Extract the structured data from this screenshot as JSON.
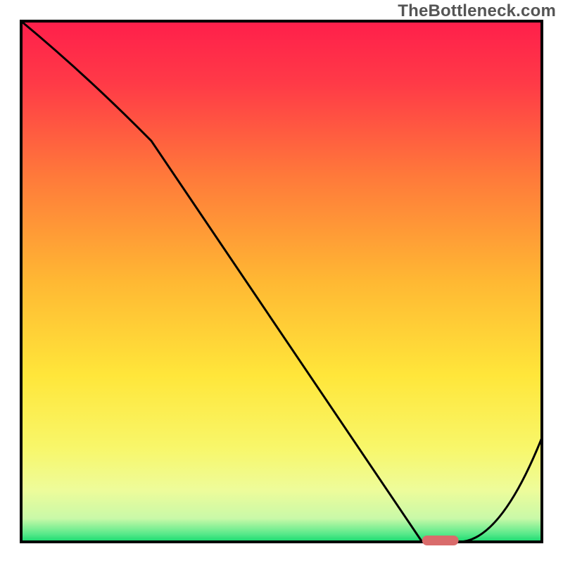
{
  "watermark": "TheBottleneck.com",
  "chart_data": {
    "type": "line",
    "title": "",
    "xlabel": "",
    "ylabel": "",
    "xlim": [
      0,
      100
    ],
    "ylim": [
      0,
      100
    ],
    "series": [
      {
        "name": "bottleneck-curve",
        "x": [
          0,
          25,
          77,
          84,
          100
        ],
        "y": [
          100,
          77,
          0,
          0,
          20
        ]
      }
    ],
    "marker": {
      "name": "optimal-zone",
      "x_range": [
        77,
        84
      ],
      "y": 0,
      "color": "#d96b6b"
    },
    "background_gradient": {
      "stops": [
        {
          "offset": 0.0,
          "color": "#ff1f4b"
        },
        {
          "offset": 0.12,
          "color": "#ff3a47"
        },
        {
          "offset": 0.3,
          "color": "#ff7a3a"
        },
        {
          "offset": 0.5,
          "color": "#ffb833"
        },
        {
          "offset": 0.68,
          "color": "#ffe63a"
        },
        {
          "offset": 0.82,
          "color": "#f8f76a"
        },
        {
          "offset": 0.9,
          "color": "#eefc9a"
        },
        {
          "offset": 0.955,
          "color": "#c9f9a8"
        },
        {
          "offset": 0.985,
          "color": "#57e98a"
        },
        {
          "offset": 1.0,
          "color": "#16d96e"
        }
      ]
    },
    "grid": false,
    "legend": false
  }
}
